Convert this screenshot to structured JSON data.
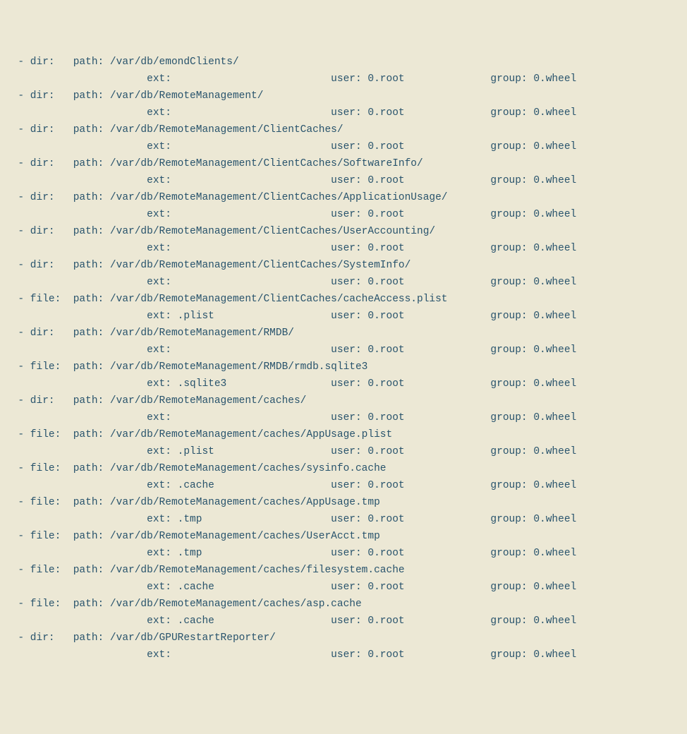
{
  "labels": {
    "dir": "dir:",
    "file": "file:",
    "path": "path:",
    "ext": "ext:",
    "user": "user:",
    "group": "group:"
  },
  "entries": [
    {
      "type": "dir",
      "path": "/var/db/emondClients/",
      "ext": "",
      "user": "0.root",
      "group": "0.wheel"
    },
    {
      "type": "dir",
      "path": "/var/db/RemoteManagement/",
      "ext": "",
      "user": "0.root",
      "group": "0.wheel"
    },
    {
      "type": "dir",
      "path": "/var/db/RemoteManagement/ClientCaches/",
      "ext": "",
      "user": "0.root",
      "group": "0.wheel"
    },
    {
      "type": "dir",
      "path": "/var/db/RemoteManagement/ClientCaches/SoftwareInfo/",
      "ext": "",
      "user": "0.root",
      "group": "0.wheel"
    },
    {
      "type": "dir",
      "path": "/var/db/RemoteManagement/ClientCaches/ApplicationUsage/",
      "ext": "",
      "user": "0.root",
      "group": "0.wheel"
    },
    {
      "type": "dir",
      "path": "/var/db/RemoteManagement/ClientCaches/UserAccounting/",
      "ext": "",
      "user": "0.root",
      "group": "0.wheel"
    },
    {
      "type": "dir",
      "path": "/var/db/RemoteManagement/ClientCaches/SystemInfo/",
      "ext": "",
      "user": "0.root",
      "group": "0.wheel"
    },
    {
      "type": "file",
      "path": "/var/db/RemoteManagement/ClientCaches/cacheAccess.plist",
      "ext": ".plist",
      "user": "0.root",
      "group": "0.wheel"
    },
    {
      "type": "dir",
      "path": "/var/db/RemoteManagement/RMDB/",
      "ext": "",
      "user": "0.root",
      "group": "0.wheel"
    },
    {
      "type": "file",
      "path": "/var/db/RemoteManagement/RMDB/rmdb.sqlite3",
      "ext": ".sqlite3",
      "user": "0.root",
      "group": "0.wheel"
    },
    {
      "type": "dir",
      "path": "/var/db/RemoteManagement/caches/",
      "ext": "",
      "user": "0.root",
      "group": "0.wheel"
    },
    {
      "type": "file",
      "path": "/var/db/RemoteManagement/caches/AppUsage.plist",
      "ext": ".plist",
      "user": "0.root",
      "group": "0.wheel"
    },
    {
      "type": "file",
      "path": "/var/db/RemoteManagement/caches/sysinfo.cache",
      "ext": ".cache",
      "user": "0.root",
      "group": "0.wheel"
    },
    {
      "type": "file",
      "path": "/var/db/RemoteManagement/caches/AppUsage.tmp",
      "ext": ".tmp",
      "user": "0.root",
      "group": "0.wheel"
    },
    {
      "type": "file",
      "path": "/var/db/RemoteManagement/caches/UserAcct.tmp",
      "ext": ".tmp",
      "user": "0.root",
      "group": "0.wheel"
    },
    {
      "type": "file",
      "path": "/var/db/RemoteManagement/caches/filesystem.cache",
      "ext": ".cache",
      "user": "0.root",
      "group": "0.wheel"
    },
    {
      "type": "file",
      "path": "/var/db/RemoteManagement/caches/asp.cache",
      "ext": ".cache",
      "user": "0.root",
      "group": "0.wheel"
    },
    {
      "type": "dir",
      "path": "/var/db/GPURestartReporter/",
      "ext": "",
      "user": "0.root",
      "group": "0.wheel"
    }
  ]
}
